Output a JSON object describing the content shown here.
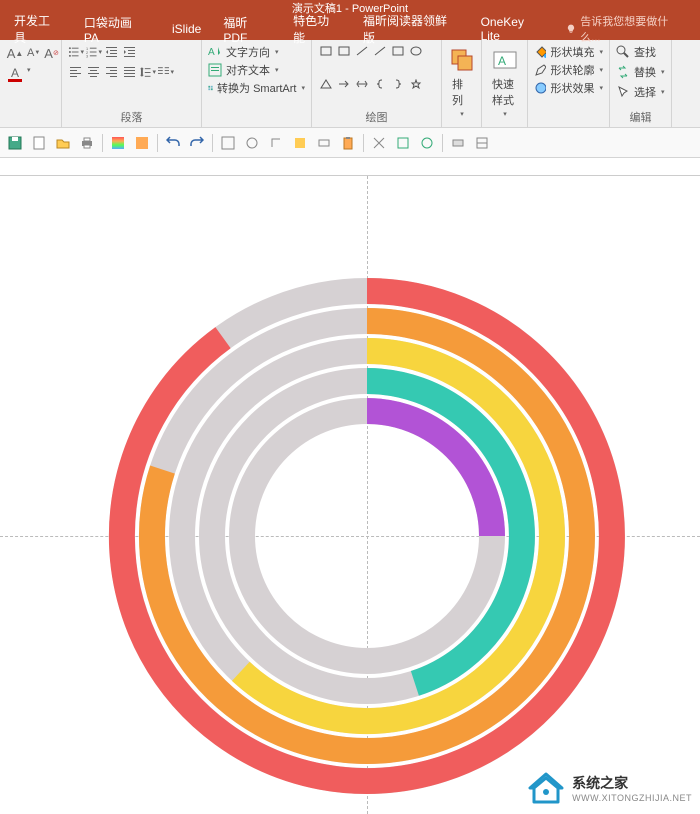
{
  "app_title": "演示文稿1 - PowerPoint",
  "tabs": [
    "开发工具",
    "口袋动画 PA",
    "iSlide",
    "福昕PDF",
    "特色功能",
    "福昕阅读器领鲜版",
    "OneKey Lite"
  ],
  "tell_me": "告诉我您想要做什么...",
  "ribbon": {
    "paragraph": {
      "label": "段落",
      "text_direction": "文字方向",
      "align_text": "对齐文本",
      "smartart": "转换为 SmartArt"
    },
    "drawing": {
      "label": "绘图",
      "arrange": "排列",
      "quick_styles": "快速样式",
      "shape_fill": "形状填充",
      "shape_outline": "形状轮廓",
      "shape_effects": "形状效果"
    },
    "editing": {
      "label": "编辑",
      "find": "查找",
      "replace": "替换",
      "select": "选择"
    }
  },
  "watermark": {
    "title": "系统之家",
    "url": "WWW.XITONGZHIJIA.NET"
  },
  "chart_data": {
    "type": "donut",
    "note": "5 concentric partial donut rings (rainbow progress style)",
    "rings": [
      {
        "name": "outer-red",
        "color": "#f05d5d",
        "percent": 90,
        "start_deg": 0
      },
      {
        "name": "orange",
        "color": "#f59b3a",
        "percent": 80,
        "start_deg": 0
      },
      {
        "name": "yellow",
        "color": "#f7d53e",
        "percent": 62,
        "start_deg": 0
      },
      {
        "name": "teal",
        "color": "#35c9b2",
        "percent": 45,
        "start_deg": 0
      },
      {
        "name": "inner-purple",
        "color": "#b253d6",
        "percent": 25,
        "start_deg": 0
      }
    ],
    "ring_bg": "#d6d1d3",
    "gap": "#ffffff"
  },
  "colors": {
    "brand_red": "#b7472a",
    "ribbon_bg": "#f1f1f1"
  }
}
